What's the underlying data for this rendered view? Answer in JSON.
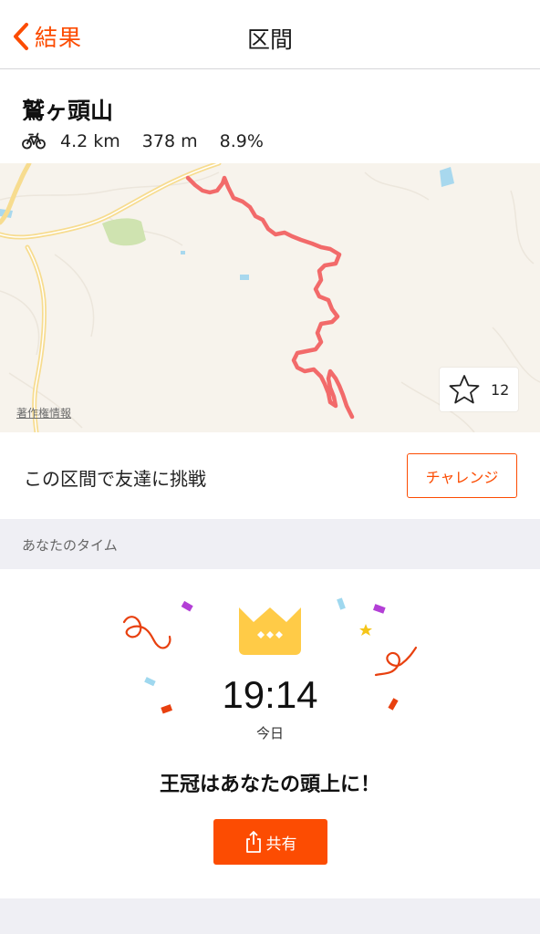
{
  "navbar": {
    "back_label": "結果",
    "title": "区間"
  },
  "segment": {
    "name": "鷲ヶ頭山",
    "activity_icon": "bicycle-icon",
    "distance": "4.2 km",
    "elevation": "378 m",
    "grade": "8.9%"
  },
  "map": {
    "attribution": "著作権情報",
    "star_count": "12",
    "route_color": "#f26a6a"
  },
  "challenge": {
    "text": "この区間で友達に挑戦",
    "button_label": "チャレンジ"
  },
  "your_time": {
    "section_label": "あなたのタイム",
    "time": "19:14",
    "date_label": "今日",
    "message": "王冠はあなたの頭上に！",
    "share_label": "共有"
  },
  "colors": {
    "accent": "#fc4c02",
    "crown": "#ffcb47",
    "section_bg": "#efeff4"
  }
}
